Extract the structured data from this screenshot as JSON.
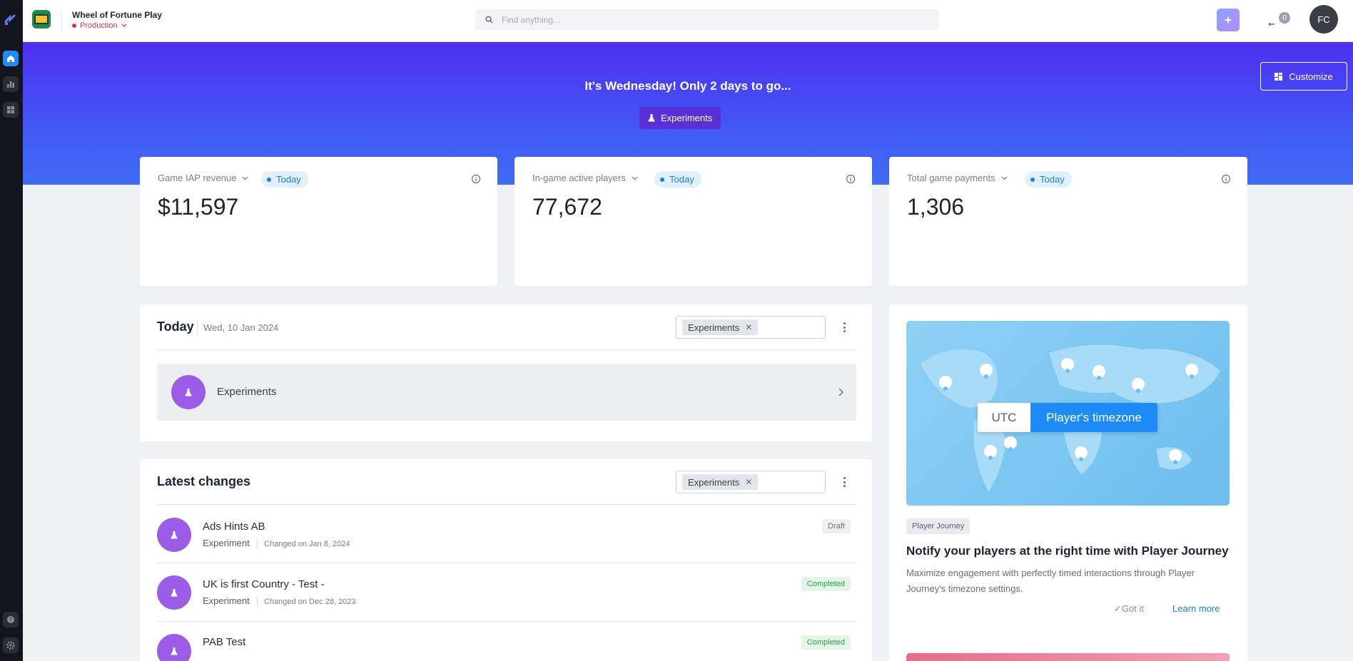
{
  "app": {
    "title": "Wheel of Fortune Play",
    "environment": "Production"
  },
  "search": {
    "placeholder": "Find anything..."
  },
  "notifications": {
    "count": "0"
  },
  "user": {
    "initials": "FC"
  },
  "hero": {
    "message": "It's Wednesday! Only 2 days to go...",
    "chip_label": "Experiments",
    "customize_label": "Customize"
  },
  "kpis": [
    {
      "label": "Game IAP revenue",
      "period": "Today",
      "value": "$11,597"
    },
    {
      "label": "In-game active players",
      "period": "Today",
      "value": "77,672"
    },
    {
      "label": "Total game payments",
      "period": "Today",
      "value": "1,306"
    }
  ],
  "today": {
    "title": "Today",
    "date": "Wed, 10 Jan 2024",
    "filter_tag": "Experiments",
    "row_label": "Experiments"
  },
  "latest": {
    "title": "Latest changes",
    "filter_tag": "Experiments",
    "items": [
      {
        "name": "Ads Hints AB",
        "type": "Experiment",
        "changed": "Changed on Jan 8, 2024",
        "status": "Draft"
      },
      {
        "name": "UK is first Country - Test -",
        "type": "Experiment",
        "changed": "Changed on Dec 28, 2023",
        "status": "Completed"
      },
      {
        "name": "PAB Test",
        "type": "Experiment",
        "changed": "",
        "status": "Completed"
      }
    ]
  },
  "promo": {
    "utc_label": "UTC",
    "player_tz_label": "Player's timezone",
    "tag": "Player Journey",
    "title": "Notify your players at the right time with Player Journey",
    "description": "Maximize engagement with perfectly timed interactions through Player Journey's timezone settings.",
    "got_it": "Got it",
    "learn_more": "Learn more"
  },
  "colors": {
    "accent": "#1d8cf8",
    "hero_start": "#4d2ff0",
    "experiment": "#9b5de5",
    "env": "#d0344a"
  }
}
